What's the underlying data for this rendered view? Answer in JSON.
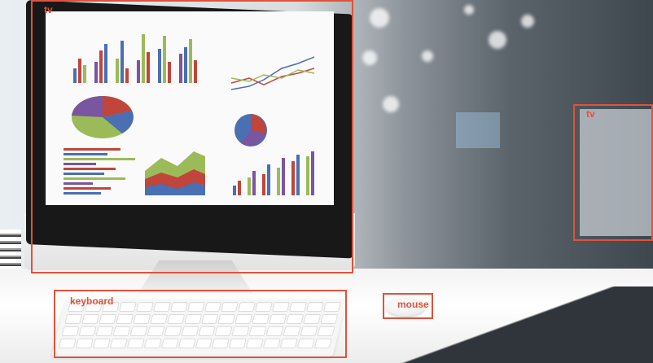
{
  "detections": [
    {
      "label": "tv"
    },
    {
      "label": "tv"
    },
    {
      "label": "keyboard"
    },
    {
      "label": "mouse"
    }
  ],
  "colors": {
    "box_outline": "#e0533a",
    "label_text": "#e0533a"
  }
}
